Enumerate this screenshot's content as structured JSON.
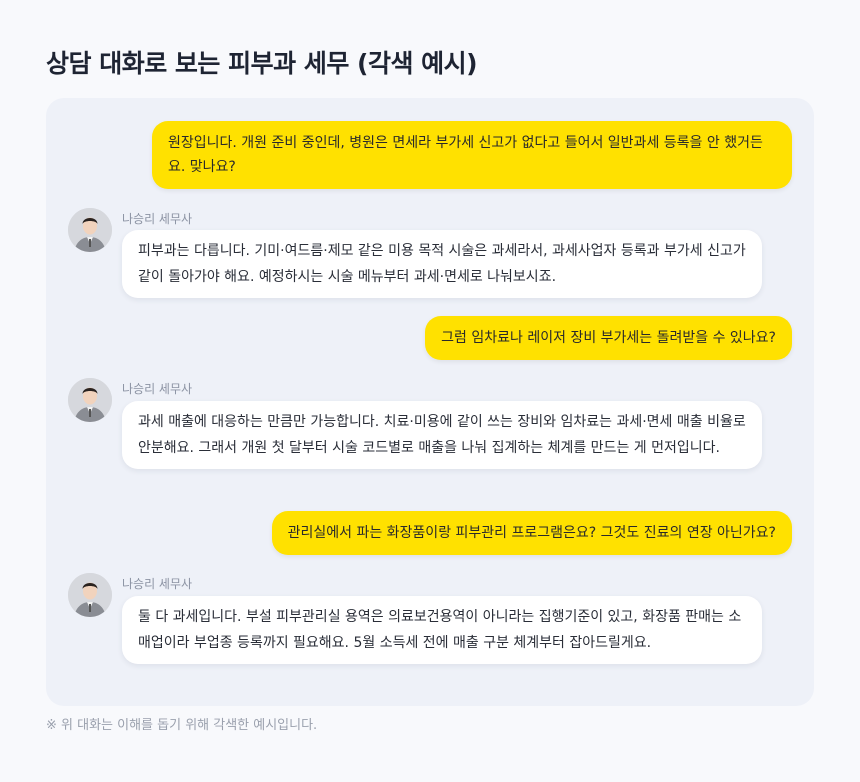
{
  "page": {
    "title": "상담 대화로 보는 피부과 세무 (각색 예시)",
    "footnote": "※ 위 대화는 이해를 돕기 위해 각색한 예시입니다."
  },
  "colors": {
    "user_bubble": "#ffe100",
    "bot_bubble": "#ffffff",
    "panel": "#eef1f8",
    "title": "#1e2433"
  },
  "messages": [
    {
      "role": "user",
      "text": "원장입니다. 개원 준비 중인데, 병원은 면세라 부가세 신고가 없다고 들어서 일반과세 등록을 안 했거든요. 맞나요?"
    },
    {
      "role": "advisor",
      "name": "나승리 세무사",
      "avatar_icon": "advisor-avatar",
      "text": "피부과는 다릅니다. 기미·여드름·제모 같은 미용 목적 시술은 과세라서, 과세사업자 등록과 부가세 신고가 같이 돌아가야 해요. 예정하시는 시술 메뉴부터 과세·면세로 나눠보시죠."
    },
    {
      "role": "user",
      "text": "그럼 임차료나 레이저 장비 부가세는 돌려받을 수 있나요?"
    },
    {
      "role": "advisor",
      "name": "나승리 세무사",
      "avatar_icon": "advisor-avatar",
      "text": "과세 매출에 대응하는 만큼만 가능합니다. 치료·미용에 같이 쓰는 장비와 임차료는 과세·면세 매출 비율로 안분해요. 그래서 개원 첫 달부터 시술 코드별로 매출을 나눠 집계하는 체계를 만드는 게 먼저입니다."
    },
    {
      "role": "user",
      "text": "관리실에서 파는 화장품이랑 피부관리 프로그램은요? 그것도 진료의 연장 아닌가요?"
    },
    {
      "role": "advisor",
      "name": "나승리 세무사",
      "avatar_icon": "advisor-avatar",
      "text": "둘 다 과세입니다. 부설 피부관리실 용역은 의료보건용역이 아니라는 집행기준이 있고, 화장품 판매는 소매업이라 부업종 등록까지 필요해요. 5월 소득세 전에 매출 구분 체계부터 잡아드릴게요."
    }
  ]
}
